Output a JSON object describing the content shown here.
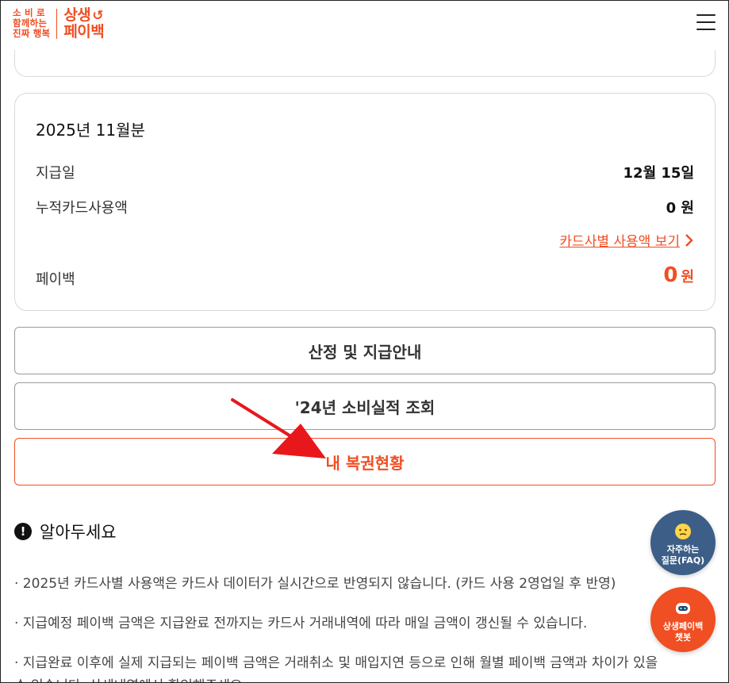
{
  "header": {
    "slogan_line1": "소 비 로",
    "slogan_line2": "함께하는",
    "slogan_line3": "진짜 행복",
    "brand_line1": "상생",
    "brand_line2": "페이백",
    "menu_icon": "hamburger-menu-icon"
  },
  "card": {
    "title": "2025년 11월분",
    "payment_date_label": "지급일",
    "payment_date_value": "12월 15일",
    "card_usage_label": "누적카드사용액",
    "card_usage_value": "0 원",
    "card_link": "카드사별 사용액 보기",
    "payback_label": "페이백",
    "payback_value": "0",
    "payback_unit": "원"
  },
  "buttons": {
    "guide": "산정 및 지급안내",
    "lookup": "'24년 소비실적 조회",
    "voucher": "내 복권현황"
  },
  "notice": {
    "title": "알아두세요",
    "items": [
      "· 2025년 카드사별 사용액은 카드사 데이터가 실시간으로 반영되지 않습니다. (카드 사용 2영업일 후 반영)",
      "· 지급예정 페이백 금액은 지급완료 전까지는 카드사 거래내역에 따라 매일 금액이 갱신될 수 있습니다.",
      "· 지급완료 이후에 실제 지급되는 페이백 금액은 거래취소 및 매입지연 등으로 인해 월별 페이백 금액과 차이가 있을",
      "수 있습니다. 상세내역에서 확인해주세요."
    ]
  },
  "fab": {
    "faq_line1": "자주하는",
    "faq_line2": "질문(FAQ)",
    "bot_line1": "상생페이백",
    "bot_line2": "챗봇"
  },
  "colors": {
    "accent": "#f04e23",
    "faq_button": "#3d5e87",
    "annotation_arrow": "#e8171c"
  }
}
